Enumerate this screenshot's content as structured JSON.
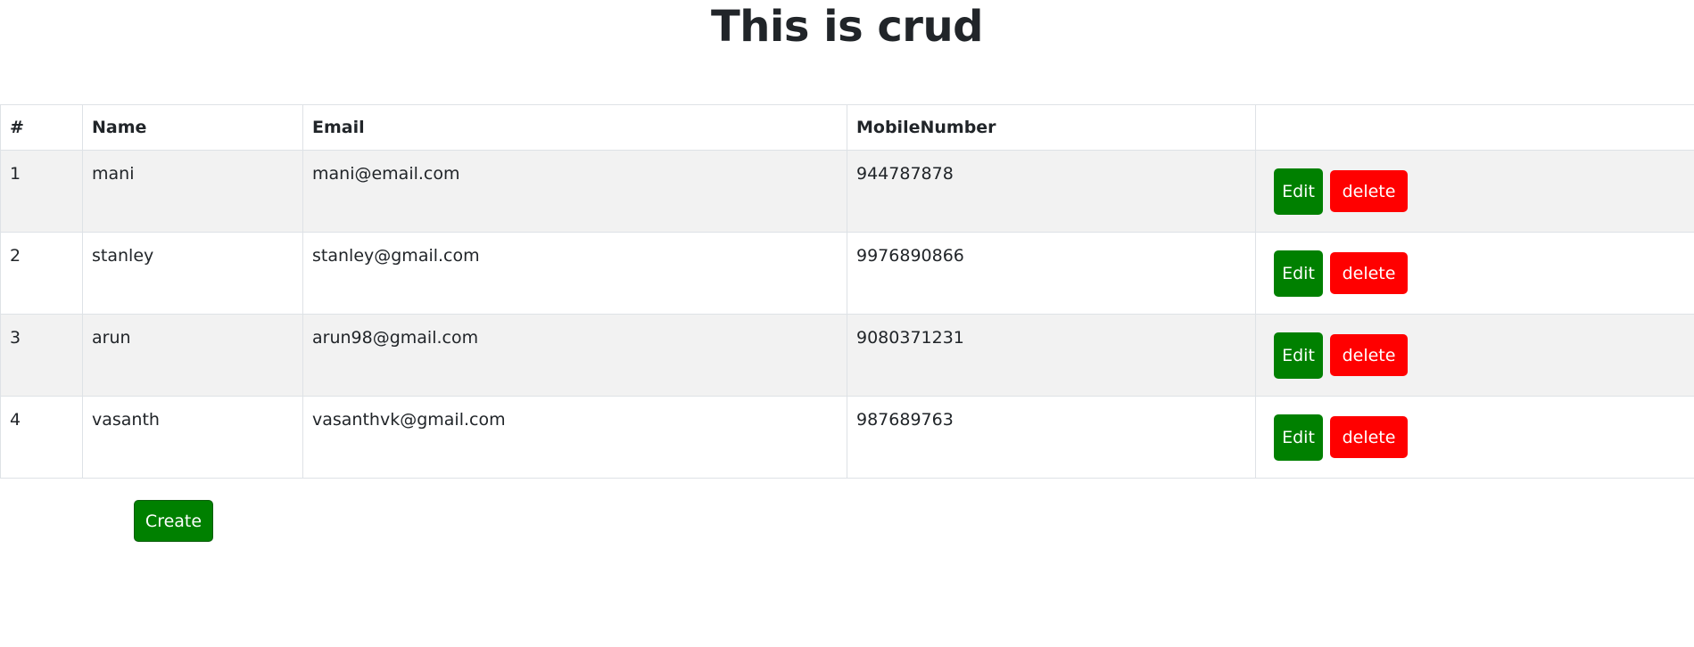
{
  "page": {
    "title": "This is crud"
  },
  "table": {
    "headers": [
      "#",
      "Name",
      "Email",
      "MobileNumber",
      ""
    ],
    "rows": [
      {
        "id": "1",
        "name": "mani",
        "email": "mani@email.com",
        "mobile": "944787878"
      },
      {
        "id": "2",
        "name": "stanley",
        "email": "stanley@gmail.com",
        "mobile": "9976890866"
      },
      {
        "id": "3",
        "name": "arun",
        "email": "arun98@gmail.com",
        "mobile": "9080371231"
      },
      {
        "id": "4",
        "name": "vasanth",
        "email": "vasanthvk@gmail.com",
        "mobile": "987689763"
      }
    ],
    "edit_label": "Edit",
    "delete_label": "delete"
  },
  "actions": {
    "create_label": "Create"
  },
  "colors": {
    "edit": "#008000",
    "delete": "#ff0000",
    "create": "#008000",
    "stripe": "#f2f2f2"
  }
}
